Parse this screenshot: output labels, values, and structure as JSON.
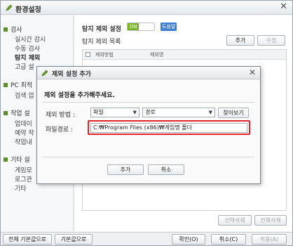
{
  "window": {
    "title": "환경설정",
    "close_glyph": "✕"
  },
  "sidebar": {
    "sections": [
      {
        "label": "검사",
        "items": [
          "실시간 감시",
          "수동 검사",
          "탐지 제외",
          "고급 설"
        ]
      },
      {
        "label": "PC 최적",
        "items": [
          "검색 업"
        ]
      },
      {
        "label": "작업 설",
        "items": [
          "업데이",
          "예약 작",
          "작업내"
        ]
      },
      {
        "label": "기타 설",
        "items": [
          "게임모",
          "로그관",
          "기타"
        ]
      }
    ],
    "active_item": "탐지 제외"
  },
  "panel": {
    "section_title": "탐지 제외 설정",
    "toggle_label": "ON",
    "help_label": "도움말",
    "list_title": "탐지 제외 목록",
    "add_button": "추가",
    "edit_button": "수정",
    "columns": [
      "제외방법",
      "제외명"
    ],
    "delete_selected_button": "선택삭제",
    "delete_all_button": "전체삭제"
  },
  "bottom_bar": {
    "reset_all_button": "전체 기본값으로",
    "reset_button": "기본값으로",
    "ok_button": "확인(O)",
    "cancel_button": "취소(C)",
    "apply_button": "적용(A)"
  },
  "dialog": {
    "title": "제외 설정 추가",
    "close_glyph": "✕",
    "heading": "제외 설정을 추가해주세요.",
    "method_label": "제외 방법 :",
    "method_value": "파일",
    "type_value": "경로",
    "browse_button": "찾아보기",
    "path_label": "파일경로 :",
    "path_value": "C:₩Program Files (x86)₩게임명 폴더",
    "add_button": "추가",
    "cancel_button": "취소"
  },
  "colors": {
    "accent_green": "#7cb32a",
    "help_blue": "#3b7fd0",
    "highlight_red": "#e1232a"
  }
}
